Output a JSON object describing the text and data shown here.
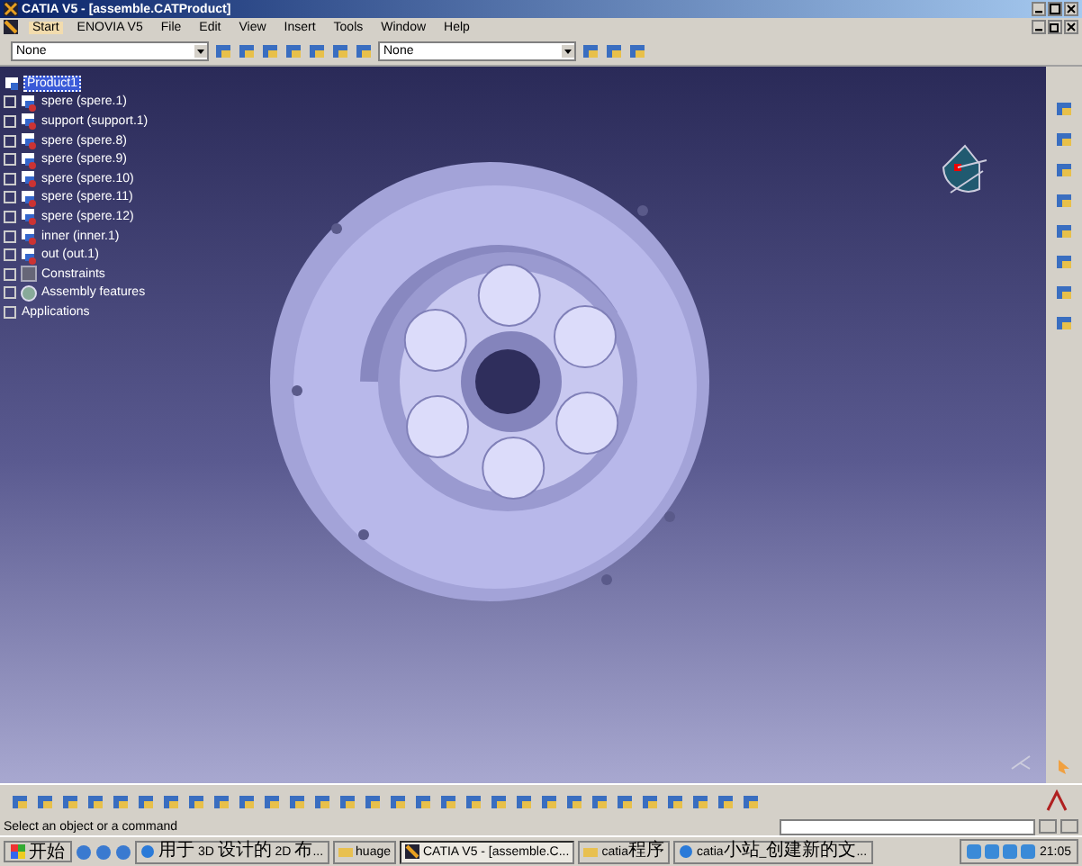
{
  "window": {
    "title": "CATIA V5 - [assemble.CATProduct]"
  },
  "menu_bar": [
    {
      "label": "Start",
      "selected": true
    },
    {
      "label": "ENOVIA V5",
      "selected": false
    },
    {
      "label": "File",
      "selected": false
    },
    {
      "label": "Edit",
      "selected": false
    },
    {
      "label": "View",
      "selected": false
    },
    {
      "label": "Insert",
      "selected": false
    },
    {
      "label": "Tools",
      "selected": false
    },
    {
      "label": "Window",
      "selected": false
    },
    {
      "label": "Help",
      "selected": false
    }
  ],
  "toolbar": {
    "dropdowns": [
      {
        "value": "None"
      },
      {
        "value": "None"
      }
    ]
  },
  "tree": {
    "label": "Product1",
    "selected": true,
    "children": [
      {
        "label": "spere (spere.1)",
        "kind": "part"
      },
      {
        "label": "support (support.1)",
        "kind": "part"
      },
      {
        "label": "spere (spere.8)",
        "kind": "part"
      },
      {
        "label": "spere (spere.9)",
        "kind": "part"
      },
      {
        "label": "spere (spere.10)",
        "kind": "part"
      },
      {
        "label": "spere (spere.11)",
        "kind": "part"
      },
      {
        "label": "spere (spere.12)",
        "kind": "part"
      },
      {
        "label": "inner (inner.1)",
        "kind": "part"
      },
      {
        "label": "out (out.1)",
        "kind": "part"
      },
      {
        "label": "Constraints",
        "kind": "constraints"
      },
      {
        "label": "Assembly features",
        "kind": "features"
      },
      {
        "label": "Applications",
        "kind": "plain"
      }
    ]
  },
  "status_bar": {
    "text": "Select an object or a command"
  },
  "taskbar": {
    "start": "开始",
    "tasks": [
      {
        "label": "用于 3D 设计的 2D 布...",
        "kind": "browser",
        "selected": false
      },
      {
        "label": "huage",
        "kind": "folder",
        "selected": false
      },
      {
        "label": "CATIA V5 - [assemble.C...",
        "kind": "app",
        "selected": true
      },
      {
        "label": "catia程序",
        "kind": "folder",
        "selected": false
      },
      {
        "label": "catia小站_创建新的文...",
        "kind": "browser",
        "selected": false
      }
    ],
    "clock": "21:05"
  }
}
